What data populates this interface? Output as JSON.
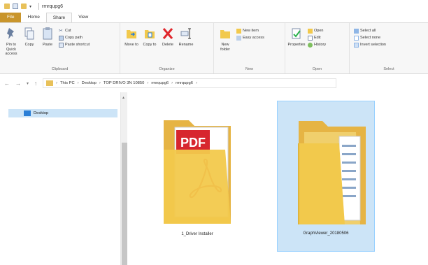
{
  "titlebar": {
    "title": "rmrqupg6"
  },
  "tabs": [
    "File",
    "Home",
    "Share",
    "View"
  ],
  "ribbon": {
    "clipboard": {
      "label": "Clipboard",
      "pin": "Pin to Quick access",
      "copy": "Copy",
      "paste": "Paste",
      "cut": "Cut",
      "copy_path": "Copy path",
      "paste_shortcut": "Paste shortcut"
    },
    "organize": {
      "label": "Organize",
      "move_to": "Move to",
      "copy_to": "Copy to",
      "delete": "Delete",
      "rename": "Rename"
    },
    "new": {
      "label": "New",
      "new_folder": "New folder",
      "new_item": "New item",
      "easy_access": "Easy access"
    },
    "open": {
      "label": "Open",
      "properties": "Properties",
      "open": "Open",
      "edit": "Edit",
      "history": "History"
    },
    "select": {
      "label": "Select",
      "select_all": "Select all",
      "select_none": "Select none",
      "invert_selection": "Invert selection"
    }
  },
  "address": {
    "crumbs": [
      "This PC",
      "Desktop",
      "TOP DRIVO 3N 10850",
      "rmrqupg6",
      "rmrqupg6"
    ]
  },
  "navpane": {
    "selected_item": "Desktop"
  },
  "files": [
    {
      "name": "1_Driver Installer",
      "pdf_text": "PDF"
    },
    {
      "name": "GraphViewer_20180506"
    }
  ],
  "colors": {
    "file_tab": "#c9952b",
    "folder": "#f2c94c",
    "selection": "#cce4f7",
    "pdf_red": "#d7262e"
  }
}
